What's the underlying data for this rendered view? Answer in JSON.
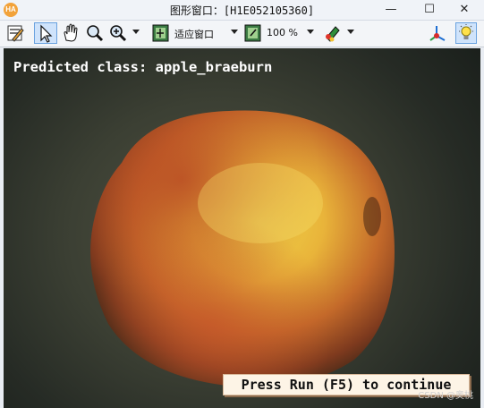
{
  "window": {
    "title": "图形窗口：[H1E052105360]",
    "app_icon_text": "HA",
    "minimize_label": "—",
    "maximize_label": "☐",
    "close_label": "✕"
  },
  "toolbar": {
    "fit_label": "适应窗口",
    "zoom_label": "100 %",
    "icons": [
      "edit-icon",
      "pointer-icon",
      "pan-hand-icon",
      "zoom-icon",
      "zoom-in-icon",
      "fit-window-icon",
      "zoom-percent-icon",
      "color-tool-icon",
      "axes-icon",
      "lightbulb-icon"
    ]
  },
  "display": {
    "prediction_text": "Predicted class: apple_braeburn",
    "continue_button": "Press Run (F5) to continue"
  },
  "watermark": "CSDN @奥桃"
}
